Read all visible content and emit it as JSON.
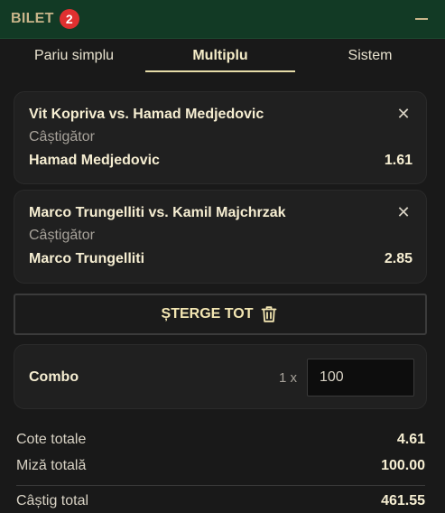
{
  "header": {
    "title": "BILET",
    "badge_count": "2",
    "collapse_icon": "minus-icon"
  },
  "tabs": [
    {
      "label": "Pariu simplu",
      "active": false
    },
    {
      "label": "Multiplu",
      "active": true
    },
    {
      "label": "Sistem",
      "active": false
    }
  ],
  "bets": [
    {
      "match": "Vit Kopriva vs. Hamad Medjedovic",
      "market": "Câștigător",
      "pick": "Hamad Medjedovic",
      "odds": "1.61"
    },
    {
      "match": "Marco Trungelliti vs. Kamil Majchrzak",
      "market": "Câștigător",
      "pick": "Marco Trungelliti",
      "odds": "2.85"
    }
  ],
  "clear_button": {
    "label": "ȘTERGE TOT",
    "icon": "trash-icon"
  },
  "combo": {
    "label": "Combo",
    "multiplier": "1 x",
    "stake": "100"
  },
  "summary": {
    "total_odds_label": "Cote totale",
    "total_odds": "4.61",
    "total_stake_label": "Miză totală",
    "total_stake": "100.00",
    "total_win_label": "Câștig total",
    "total_win": "461.55"
  },
  "colors": {
    "header_bg": "#123a25",
    "accent": "#e6dca8",
    "badge": "#e03030",
    "background": "#191919"
  }
}
